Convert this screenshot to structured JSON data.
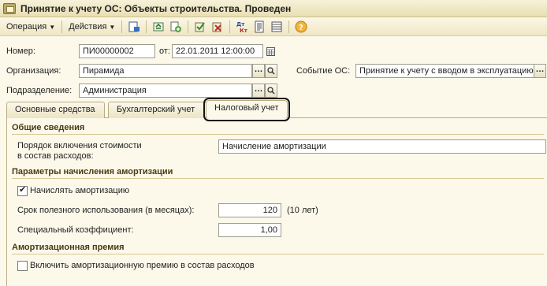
{
  "window": {
    "title": "Принятие к учету ОС: Объекты строительства. Проведен"
  },
  "toolbar": {
    "operation_label": "Операция",
    "actions_label": "Действия",
    "icons": [
      "post-document-icon",
      "refresh-icon",
      "copy-icon",
      "post-icon",
      "unpost-icon",
      "dt-kt-icon",
      "print-icon",
      "list-icon",
      "help-icon"
    ]
  },
  "header": {
    "number_label": "Номер:",
    "number_value": "ПИ00000002",
    "date_label": "от:",
    "date_value": "22.01.2011 12:00:00",
    "organization_label": "Организация:",
    "organization_value": "Пирамида",
    "event_label": "Событие ОС:",
    "event_value": "Принятие к учету с вводом в эксплуатацию",
    "department_label": "Подразделение:",
    "department_value": "Администрация"
  },
  "tabs": [
    {
      "label": "Основные средства",
      "active": false
    },
    {
      "label": "Бухгалтерский учет",
      "active": false
    },
    {
      "label": "Налоговый учет",
      "active": true
    }
  ],
  "tax": {
    "general_section": "Общие сведения",
    "expense_order_label_line1": "Порядок включения стоимости",
    "expense_order_label_line2": "в состав расходов:",
    "expense_order_value": "Начисление амортизации",
    "depreciation_section": "Параметры начисления амортизации",
    "accrue_depreciation_label": "Начислять амортизацию",
    "accrue_depreciation_checked": true,
    "useful_life_label": "Срок полезного использования (в месяцах):",
    "useful_life_value": "120",
    "useful_life_years": "(10 лет)",
    "special_coef_label": "Специальный коэффициент:",
    "special_coef_value": "1,00",
    "bonus_section": "Амортизационная премия",
    "include_bonus_label": "Включить амортизационную премию в состав расходов",
    "include_bonus_checked": false
  }
}
